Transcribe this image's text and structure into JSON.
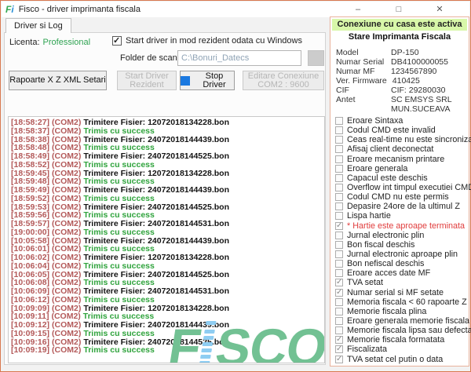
{
  "window": {
    "title": "Fisco - driver imprimanta fiscala",
    "icon": {
      "f": "F",
      "i": "i"
    },
    "caption_buttons": {
      "minimize": "–",
      "maximize": "□",
      "close": "✕"
    }
  },
  "tab": {
    "label": "Driver si Log"
  },
  "license": {
    "label": "Licenta:",
    "value": "Professional"
  },
  "resident": {
    "label": "Start driver in mod rezident odata cu Windows",
    "checked": true
  },
  "folder": {
    "label": "Folder de scanat",
    "value": "C:\\Bonuri_Datecs"
  },
  "toolbar": {
    "reports": "Rapoarte X Z  XML  Setari",
    "start_line1": "Start Driver",
    "start_line2": "Rezident",
    "stop": "Stop Driver",
    "edit_line1": "Editare Conexiune",
    "edit_line2": "COM2 : 9600"
  },
  "log": {
    "entries": [
      {
        "time": "[18:58:27]",
        "port": "(COM2)",
        "message": "Trimitere Fisier: 12072018134228.bon",
        "type": "send"
      },
      {
        "time": "[18:58:37]",
        "port": "(COM2)",
        "message": "Trimis cu success",
        "type": "ok"
      },
      {
        "time": "[18:58:38]",
        "port": "(COM2)",
        "message": "Trimitere Fisier: 24072018144439.bon",
        "type": "send"
      },
      {
        "time": "[18:58:48]",
        "port": "(COM2)",
        "message": "Trimis cu success",
        "type": "ok"
      },
      {
        "time": "[18:58:49]",
        "port": "(COM2)",
        "message": "Trimitere Fisier: 24072018144525.bon",
        "type": "send"
      },
      {
        "time": "[18:58:52]",
        "port": "(COM2)",
        "message": "Trimis cu success",
        "type": "ok"
      },
      {
        "time": "[18:59:45]",
        "port": "(COM2)",
        "message": "Trimitere Fisier: 12072018134228.bon",
        "type": "send"
      },
      {
        "time": "[18:59:48]",
        "port": "(COM2)",
        "message": "Trimis cu success",
        "type": "ok"
      },
      {
        "time": "[18:59:49]",
        "port": "(COM2)",
        "message": "Trimitere Fisier: 24072018144439.bon",
        "type": "send"
      },
      {
        "time": "[18:59:52]",
        "port": "(COM2)",
        "message": "Trimis cu success",
        "type": "ok"
      },
      {
        "time": "[18:59:53]",
        "port": "(COM2)",
        "message": "Trimitere Fisier: 24072018144525.bon",
        "type": "send"
      },
      {
        "time": "[18:59:56]",
        "port": "(COM2)",
        "message": "Trimis cu success",
        "type": "ok"
      },
      {
        "time": "[18:59:57]",
        "port": "(COM2)",
        "message": "Trimitere Fisier: 24072018144531.bon",
        "type": "send"
      },
      {
        "time": "[19:00:00]",
        "port": "(COM2)",
        "message": "Trimis cu success",
        "type": "ok"
      },
      {
        "time": "[10:05:58]",
        "port": "(COM2)",
        "message": "Trimitere Fisier: 24072018144439.bon",
        "type": "send"
      },
      {
        "time": "[10:06:01]",
        "port": "(COM2)",
        "message": "Trimis cu success",
        "type": "ok"
      },
      {
        "time": "[10:06:02]",
        "port": "(COM2)",
        "message": "Trimitere Fisier: 12072018134228.bon",
        "type": "send"
      },
      {
        "time": "[10:06:04]",
        "port": "(COM2)",
        "message": "Trimis cu success",
        "type": "ok"
      },
      {
        "time": "[10:06:05]",
        "port": "(COM2)",
        "message": "Trimitere Fisier: 24072018144525.bon",
        "type": "send"
      },
      {
        "time": "[10:06:08]",
        "port": "(COM2)",
        "message": "Trimis cu success",
        "type": "ok"
      },
      {
        "time": "[10:06:09]",
        "port": "(COM2)",
        "message": "Trimitere Fisier: 24072018144531.bon",
        "type": "send"
      },
      {
        "time": "[10:06:12]",
        "port": "(COM2)",
        "message": "Trimis cu success",
        "type": "ok"
      },
      {
        "time": "[10:09:09]",
        "port": "(COM2)",
        "message": "Trimitere Fisier: 12072018134228.bon",
        "type": "send"
      },
      {
        "time": "[10:09:11]",
        "port": "(COM2)",
        "message": "Trimis cu success",
        "type": "ok"
      },
      {
        "time": "[10:09:12]",
        "port": "(COM2)",
        "message": "Trimitere Fisier: 24072018144439.bon",
        "type": "send"
      },
      {
        "time": "[10:09:15]",
        "port": "(COM2)",
        "message": "Trimis cu success",
        "type": "ok"
      },
      {
        "time": "[10:09:16]",
        "port": "(COM2)",
        "message": "Trimitere Fisier: 24072018144525.bon",
        "type": "send"
      },
      {
        "time": "[10:09:19]",
        "port": "(COM2)",
        "message": "Trimis cu success",
        "type": "ok"
      }
    ]
  },
  "logo": {
    "f": "F",
    "sco": "SCO"
  },
  "status_panel": {
    "banner": "Conexiune cu casa este activa",
    "title": "Stare Imprimanta Fiscala",
    "info": [
      {
        "label": "Model",
        "value": "DP-150"
      },
      {
        "label": "Numar Serial",
        "value": "DB4100000055"
      },
      {
        "label": "Numar MF",
        "value": "1234567890"
      },
      {
        "label": "Ver. Firmware",
        "value": "410425"
      },
      {
        "label": "CIF",
        "value": "CIF: 29280030"
      },
      {
        "label": "Antet",
        "value": "SC EMSYS SRL",
        "value2": "MUN.SUCEAVA"
      }
    ],
    "flags": [
      {
        "label": "Eroare Sintaxa",
        "checked": false
      },
      {
        "label": "Codul CMD este invalid",
        "checked": false
      },
      {
        "label": "Ceas real-time nu este sincronizat",
        "checked": false
      },
      {
        "label": "Afisaj client deconectat",
        "checked": false
      },
      {
        "label": "Eroare mecanism printare",
        "checked": false
      },
      {
        "label": "Eroare generala",
        "checked": false
      },
      {
        "label": "Capacul este deschis",
        "checked": false
      },
      {
        "label": "Overflow int timpul executiei CMD",
        "checked": false
      },
      {
        "label": "Codul CMD nu este permis",
        "checked": false
      },
      {
        "label": "Depasire 24ore de la ultimul Z",
        "checked": false
      },
      {
        "label": "Lispa hartie",
        "checked": false
      },
      {
        "label": "* Hartie este aproape terminata",
        "checked": true,
        "alert": true
      },
      {
        "label": "Jurnal electronic plin",
        "checked": false
      },
      {
        "label": "Bon fiscal deschis",
        "checked": false
      },
      {
        "label": "Jurnal electronic aproape plin",
        "checked": false
      },
      {
        "label": "Bon nefiscal deschis",
        "checked": false
      },
      {
        "label": "Eroare acces date MF",
        "checked": false
      },
      {
        "label": "TVA setat",
        "checked": true
      },
      {
        "label": "Numar serial si MF setate",
        "checked": true
      },
      {
        "label": "Memoria fiscala < 60 rapoarte Z",
        "checked": false
      },
      {
        "label": "Memorie fiscala plina",
        "checked": false
      },
      {
        "label": "Eroare generala memorie fiscala",
        "checked": false
      },
      {
        "label": "Memorie fiscala lipsa sau defecta",
        "checked": false
      },
      {
        "label": "Memorie fiscala formatata",
        "checked": true
      },
      {
        "label": "Fiscalizata",
        "checked": true
      },
      {
        "label": "TVA setat cel putin o data",
        "checked": true
      }
    ]
  },
  "colors": {
    "window_border": "#d97950",
    "banner_green": "#d8f7a9",
    "success_green": "#2fa33c",
    "log_time_red": "#b35959",
    "alert_red": "#e03c3c",
    "license_green": "#2fa352",
    "logo_green": "#72c193",
    "logo_blue": "#8ecdf2",
    "stop_blue": "#1b79e0"
  }
}
